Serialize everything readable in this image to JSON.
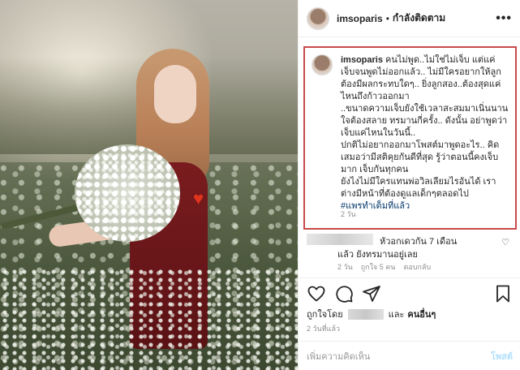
{
  "post": {
    "username": "imsoparis",
    "separator": "•",
    "follow_label": "กำลังติดตาม",
    "more_label": "•••"
  },
  "caption": {
    "username": "imsoparis",
    "lines": [
      " คนไม่พูด..ไม่ใช่ไม่เจ็บ แต่แค่เจ็บจนพูดไม่ออกแล้ว.. ไม่มีใครอยากให้ลูกต้องมีผลกระทบใดๆ.. ยิ่งลูกสอง..ต้องสุดแค่ไหนถึงก้าวออกมา",
      "..ขนาดความเจ็บยังใช้เวลาสะสมมาเนิ่นนานใจต้องสลาย ทรมานกี่ครั้ง.. ดังนั้น อย่าพูดว่าเจ็บแค่ไหนในวันนี้..",
      "ปกติไม่อยากออกมาโพสต์มาพูดอะไร.. คิดเสมอว่ามีสติคุยกันดีที่สุด รู้ว่าตอนนี้คงเจ็บมาก เจ็บกันทุกคน",
      "ยังไงไม่มีใครแทนพ่อวิลเลียมไรอันได้ เราต่างมีหน้าที่ต้องดูแลเด็กๆตลอดไป"
    ],
    "hashtag": "#แพรทำเต็มที่แล้ว",
    "time": "2 วัน"
  },
  "comment": {
    "text": "หัวอกเดวกัน 7 เดือน",
    "text2": "แล้ว ยังทรมานอยู่เลย",
    "time": "2 วัน",
    "likes": "ถูกใจ 5 คน",
    "reply": "ตอบกลับ"
  },
  "icons": {
    "like": "heart-icon",
    "comment": "comment-icon",
    "share": "share-icon",
    "save": "bookmark-icon"
  },
  "likes": {
    "prefix": "ถูกใจโดย",
    "connector": "และ",
    "others": "คนอื่นๆ"
  },
  "post_time": "2 วันที่แล้ว",
  "add_comment": {
    "placeholder": "เพิ่มความคิดเห็น",
    "post_label": "โพสต์"
  },
  "colors": {
    "highlight_border": "#c94a4a",
    "hashtag": "#003569",
    "post_button_disabled": "#b2dffc"
  }
}
